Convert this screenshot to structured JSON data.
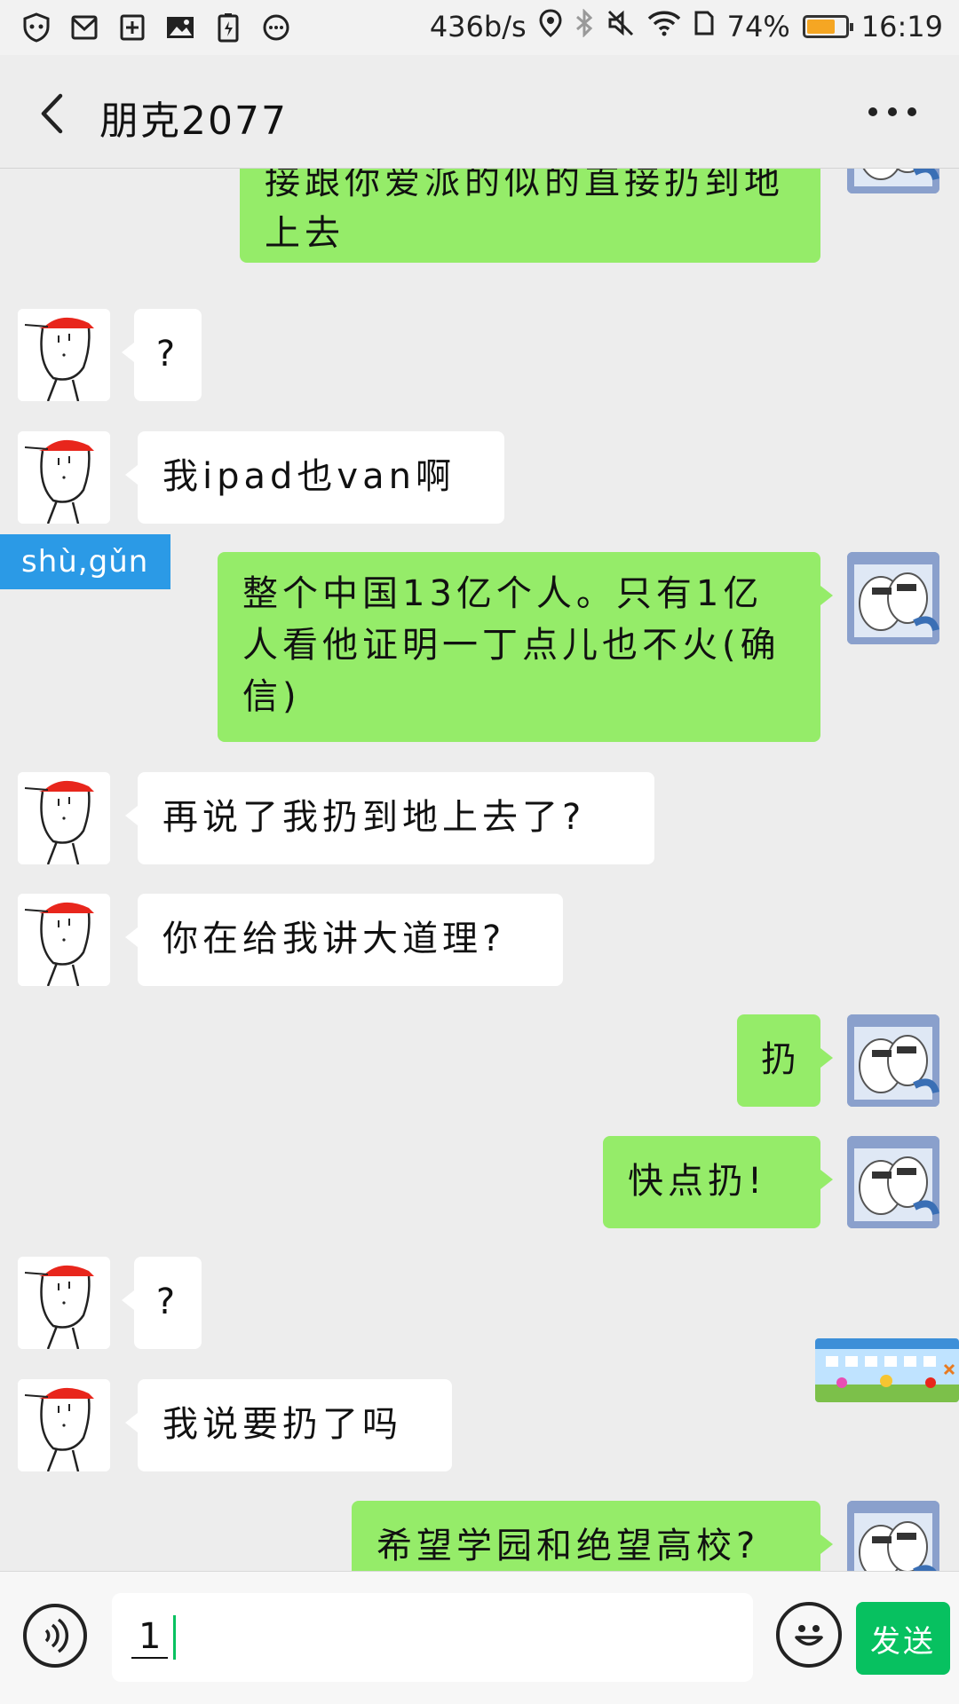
{
  "status_bar": {
    "net_speed": "436b/s",
    "battery_percent_text": "74%",
    "battery_level": 0.74,
    "time": "16:19",
    "left_icons": [
      "shield-icon",
      "mail-icon",
      "add-icon",
      "image-icon",
      "battery-saver-icon",
      "more-dots-icon"
    ]
  },
  "header": {
    "title": "朋克2077"
  },
  "messages": [
    {
      "side": "out",
      "text": "接跟你爱派的似的直接扔到地上去"
    },
    {
      "side": "in",
      "text": "?"
    },
    {
      "side": "in",
      "text": "我ipad也van啊"
    },
    {
      "side": "out",
      "text": "整个中国13亿个人。只有1亿人看他证明一丁点儿也不火(确信)"
    },
    {
      "side": "in",
      "text": "再说了我扔到地上去了?"
    },
    {
      "side": "in",
      "text": "你在给我讲大道理?"
    },
    {
      "side": "out",
      "text": "扔"
    },
    {
      "side": "out",
      "text": "快点扔!"
    },
    {
      "side": "in",
      "text": "?"
    },
    {
      "side": "in",
      "text": "我说要扔了吗"
    },
    {
      "side": "out",
      "text": "希望学园和绝望高校?"
    }
  ],
  "pinyin_tag": "shù,gǔn",
  "input": {
    "value": "1",
    "send_label": "发送"
  },
  "colors": {
    "bubble_out": "#95ec69",
    "bubble_in": "#ffffff",
    "send_button": "#07c160",
    "pinyin_tag": "#2b9ae6"
  }
}
